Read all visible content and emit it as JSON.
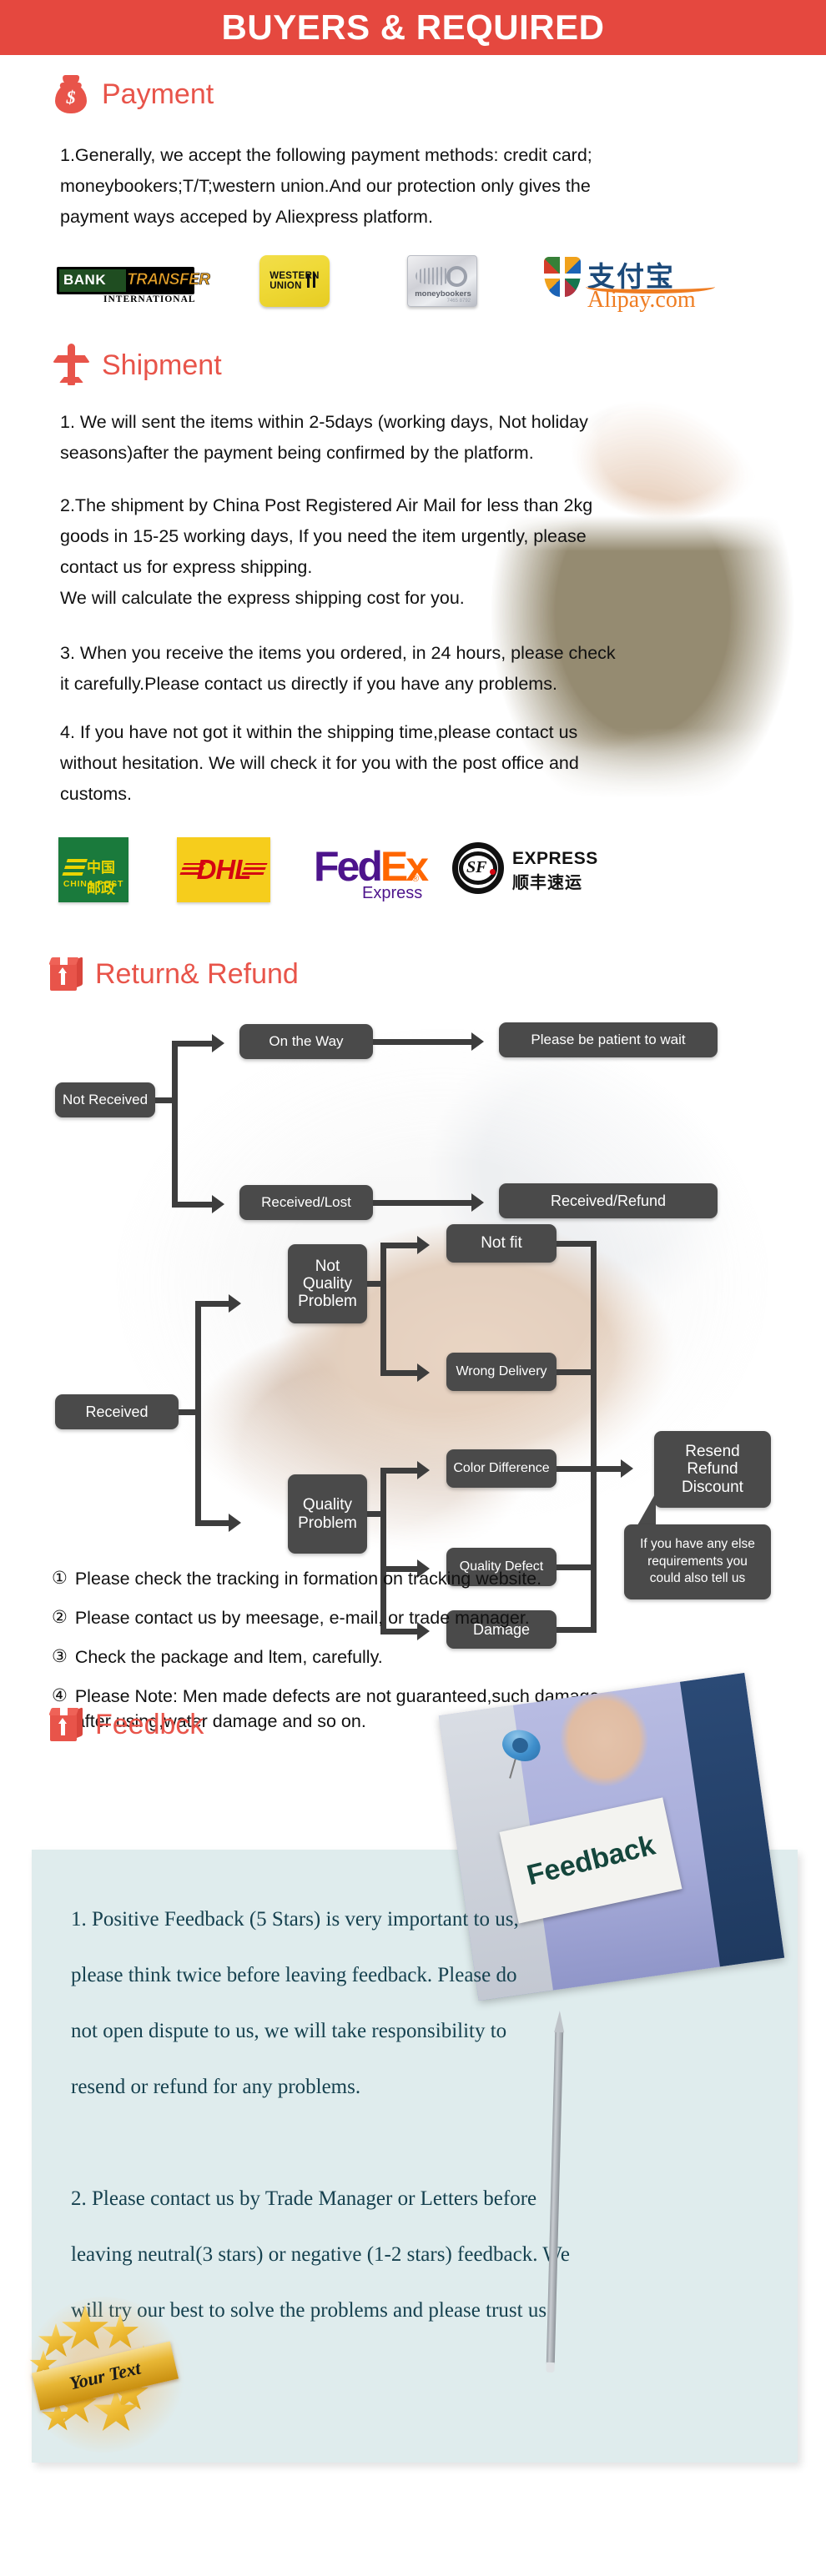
{
  "banner": {
    "title": "BUYERS & REQUIRED"
  },
  "payment": {
    "heading": "Payment",
    "icon": "money-bag-icon",
    "body": "1.Generally, we accept the following payment methods: credit card;\nmoneybookers;T/T;western union.And our protection only gives the\npayment ways acceped by Aliexpress platform.",
    "logos": [
      {
        "name": "bank-transfer-logo",
        "primary": "BANK",
        "secondary": "TRANSFER",
        "tertiary": "INTERNATIONAL"
      },
      {
        "name": "western-union-logo",
        "primary": "WESTERN",
        "secondary": "UNION"
      },
      {
        "name": "moneybookers-logo",
        "primary": "moneybookers",
        "secondary": "7465 8792"
      },
      {
        "name": "alipay-logo",
        "primary": "支付宝",
        "secondary": "Alipay.com"
      }
    ]
  },
  "shipment": {
    "heading": "Shipment",
    "icon": "airplane-icon",
    "para1": "1. We will sent the items within 2-5days (working days, Not holiday\nseasons)after the payment being confirmed by the platform.",
    "para2": "2.The shipment by China Post Registered Air Mail for less than  2kg\ngoods in 15-25 working days, If  you need the item urgently, please\ncontact us for express shipping.\nWe will calculate the express shipping cost for you.",
    "para3": "3. When you receive the items you ordered, in 24 hours, please check\n it carefully.Please contact us directly if you have any problems.",
    "para4": "4. If you have not got it within the shipping time,please contact us\nwithout hesitation. We will check it for you with the post office and\ncustoms.",
    "logos": [
      {
        "name": "china-post-logo",
        "primary": "中国邮政",
        "secondary": "CHINA POST"
      },
      {
        "name": "dhl-logo",
        "primary": "DHL"
      },
      {
        "name": "fedex-logo",
        "primary": "Fed",
        "secondary": "Ex",
        "tertiary": "Express",
        "mark": "®"
      },
      {
        "name": "sf-express-logo",
        "primary": "SF",
        "secondary": "EXPRESS",
        "tertiary": "顺丰速运"
      }
    ]
  },
  "returns": {
    "heading": "Return& Refund",
    "icon": "box-icon",
    "flow_top": {
      "start": "Not Received",
      "branch_a": "On the Way",
      "branch_a_result": "Please be patient to wait",
      "branch_b": "Received/Lost",
      "branch_b_result": "Received/Refund"
    },
    "flow_bottom": {
      "start": "Received",
      "branch_a": "Not\nQuality\nProblem",
      "branch_a_items": [
        "Not fit",
        "Wrong Delivery"
      ],
      "branch_b": "Quality\nProblem",
      "branch_b_items": [
        "Color Difference",
        "Quality Defect",
        "Damage"
      ],
      "result": "Resend\nRefund\nDiscount",
      "callout": "If you have any else\nrequirements you\ncould also tell us"
    },
    "notes": [
      {
        "num": "①",
        "text": "Please check the tracking in formation on tracking website."
      },
      {
        "num": "②",
        "text": "Please contact us by meesage, e-mail, or trade manager."
      },
      {
        "num": "③",
        "text": "Check the package and ltem, carefully."
      },
      {
        "num": "④",
        "text": "Please Note: Men made defects  are not guaranteed,such damage\n    after using,water damage and so on."
      }
    ]
  },
  "feedback": {
    "heading": "Feedbck",
    "icon": "box-icon",
    "photo_sign_text": "Feedback",
    "body": "1. Positive Feedback (5 Stars) is very important to us,\nplease think twice before leaving feedback. Please do\nnot open dispute to us,   we will take responsibility to\nresend or refund for any problems.\n\n2. Please contact us by Trade Manager or Letters before\nleaving neutral(3 stars) or negative (1-2 stars) feedback. We\nwill try our best to solve the problems and please trust us",
    "badge_text": "Your Text"
  },
  "colors": {
    "banner_bg": "#e5483f",
    "heading_red": "#e8544a",
    "flow_box": "#4a4a4a",
    "feedback_card": "#dfeced",
    "feedback_text": "#16414f"
  }
}
